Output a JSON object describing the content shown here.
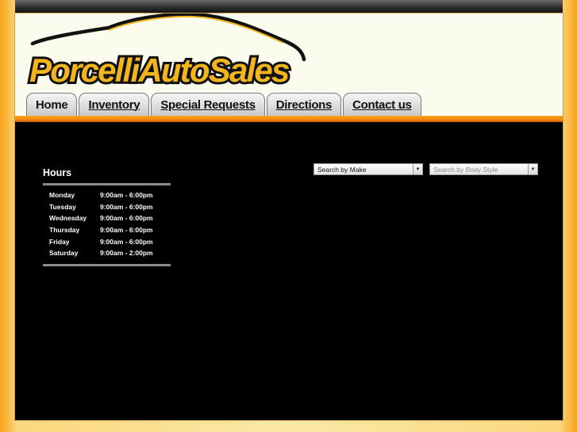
{
  "brand": {
    "logo_text": "PorcelliAutoSales"
  },
  "nav": {
    "tabs": [
      {
        "label": "Home",
        "active": true
      },
      {
        "label": "Inventory"
      },
      {
        "label": "Special Requests"
      },
      {
        "label": "Directions"
      },
      {
        "label": "Contact us"
      }
    ]
  },
  "hours": {
    "title": "Hours",
    "rows": [
      {
        "day": "Monday",
        "time": "9:00am - 6:00pm"
      },
      {
        "day": "Tuesday",
        "time": "9:00am - 6:00pm"
      },
      {
        "day": "Wednesday",
        "time": "9:00am - 6:00pm"
      },
      {
        "day": "Thursday",
        "time": "9:00am - 6:00pm"
      },
      {
        "day": "Friday",
        "time": "9:00am - 6:00pm"
      },
      {
        "day": "Saturday",
        "time": "9:00am - 2:00pm"
      }
    ]
  },
  "search": {
    "make_label": "Search by Make",
    "body_style_label": "Search by Body Style"
  },
  "colors": {
    "accent_orange": "#f07d0c",
    "header_bg": "#fbfbee",
    "content_bg": "#000000"
  }
}
